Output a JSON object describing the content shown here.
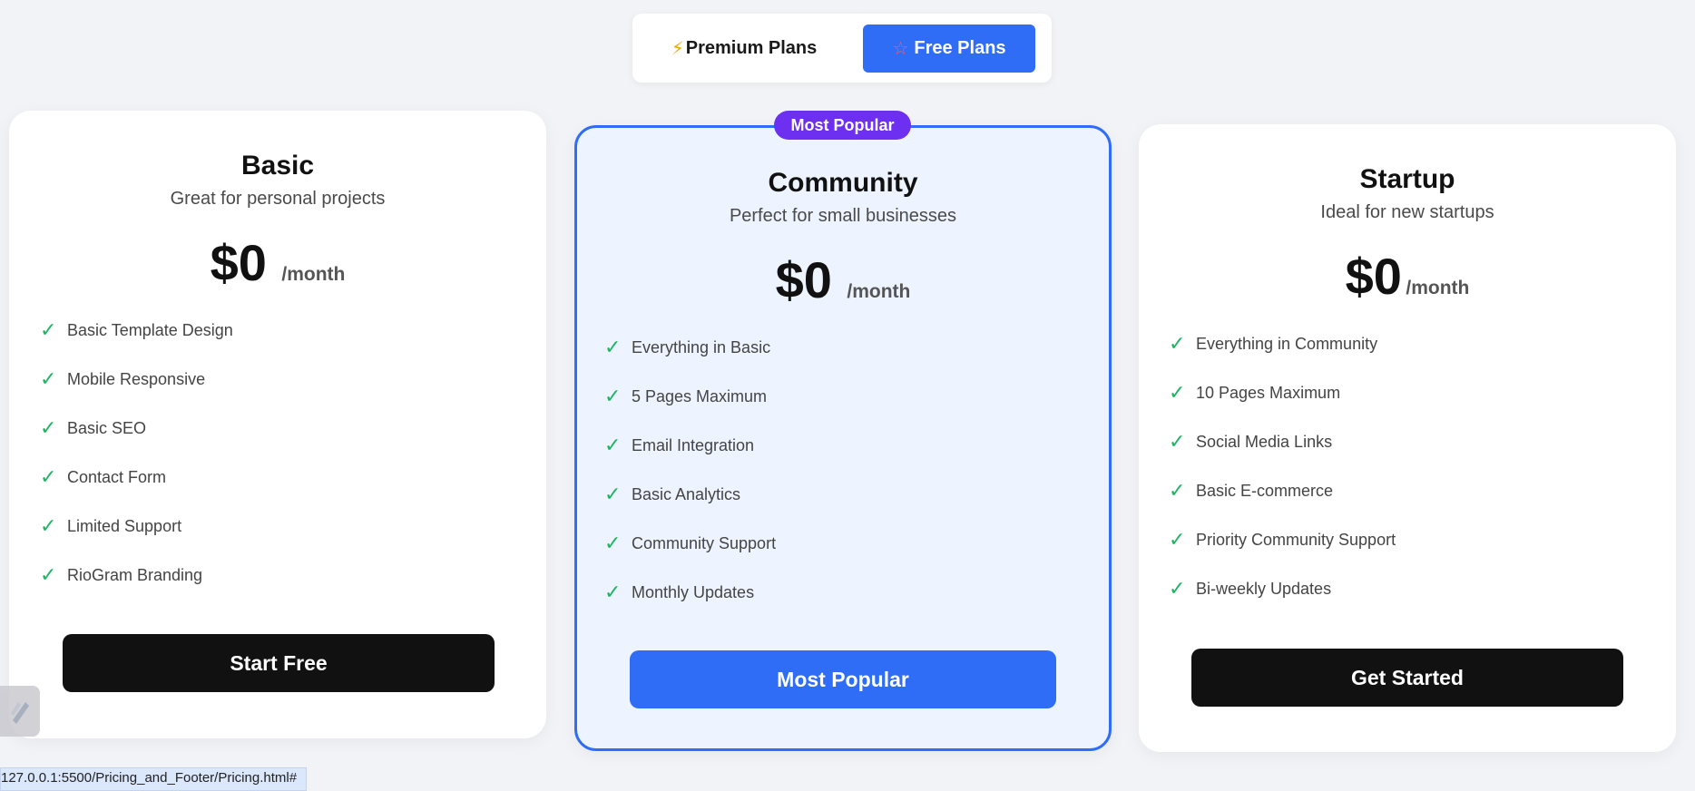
{
  "toggle": {
    "premium_label": "Premium Plans",
    "free_label": "Free Plans",
    "active": "Free Plans"
  },
  "plans": [
    {
      "name": "Basic",
      "subtitle": "Great for personal projects",
      "price": "$0",
      "period": "/month",
      "features": [
        "Basic Template Design",
        "Mobile Responsive",
        "Basic SEO",
        "Contact Form",
        "Limited Support",
        "RioGram Branding"
      ],
      "cta": "Start Free"
    },
    {
      "name": "Community",
      "subtitle": "Perfect for small businesses",
      "price": "$0",
      "period": "/month",
      "badge": "Most Popular",
      "features": [
        "Everything in Basic",
        "5 Pages Maximum",
        "Email Integration",
        "Basic Analytics",
        "Community Support",
        "Monthly Updates"
      ],
      "cta": "Most Popular"
    },
    {
      "name": "Startup",
      "subtitle": "Ideal for new startups",
      "price": "$0",
      "period": "/month",
      "features": [
        "Everything in Community",
        "10 Pages Maximum",
        "Social Media Links",
        "Basic E-commerce",
        "Priority Community Support",
        "Bi-weekly Updates"
      ],
      "cta": "Get Started"
    }
  ],
  "status_url": "127.0.0.1:5500/Pricing_and_Footer/Pricing.html#",
  "colors": {
    "accent_blue": "#2f6df6",
    "badge_purple": "#6d2ff0",
    "check_green": "#20b463",
    "dark_button": "#111111"
  },
  "icons": {
    "premium": "lightning-bolt-icon",
    "free": "star-outline-icon",
    "feature": "checkmark-icon",
    "corner": "pen-tool-icon"
  }
}
